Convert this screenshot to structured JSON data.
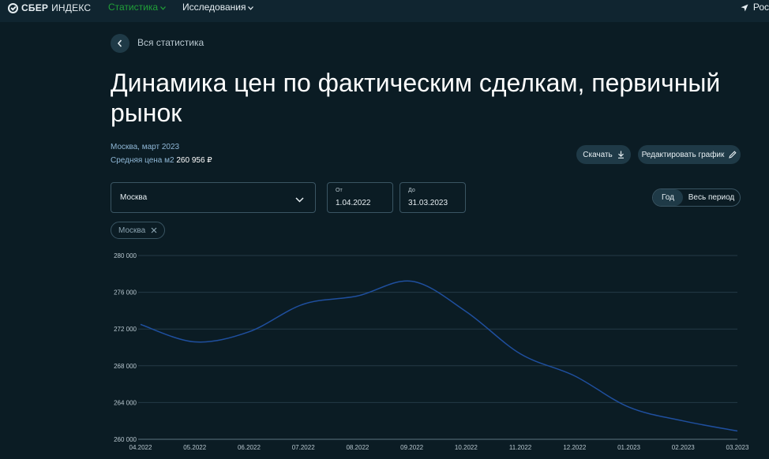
{
  "header": {
    "logo_strong": "СБЕР",
    "logo_light": "ИНДЕКС",
    "nav": [
      {
        "label": "Статистика"
      },
      {
        "label": "Исследования"
      }
    ],
    "region": "Рос"
  },
  "back_label": "Вся статистика",
  "title": "Динамика цен по фактическим сделкам, первичный рынок",
  "meta": {
    "location_date": "Москва, март 2023",
    "avg_label": "Средняя цена м2",
    "avg_value": "260 956 ₽"
  },
  "actions": {
    "download": "Скачать",
    "edit": "Редактировать график"
  },
  "filters": {
    "city": "Москва",
    "from_label": "От",
    "from_value": "1.04.2022",
    "to_label": "До",
    "to_value": "31.03.2023",
    "period_year": "Год",
    "period_all": "Весь период",
    "chip": "Москва"
  },
  "colors": {
    "background": "#0b1c24",
    "accent_green": "#21a038",
    "line": "#1f4f9e",
    "grid": "#243a46"
  },
  "chart_data": {
    "type": "line",
    "title": "",
    "x": [
      "04.2022",
      "05.2022",
      "06.2022",
      "07.2022",
      "08.2022",
      "09.2022",
      "10.2022",
      "11.2022",
      "12.2022",
      "01.2023",
      "02.2023",
      "03.2023"
    ],
    "series": [
      {
        "values": [
          272500,
          270600,
          271700,
          274700,
          275600,
          277200,
          273900,
          269300,
          266900,
          263500,
          262000,
          260900
        ]
      }
    ],
    "yticks": [
      260000,
      264000,
      268000,
      272000,
      276000,
      280000
    ],
    "ytick_labels": [
      "260 000",
      "264 000",
      "268 000",
      "272 000",
      "276 000",
      "280 000"
    ],
    "ylim": [
      260000,
      280000
    ],
    "grid": true
  }
}
